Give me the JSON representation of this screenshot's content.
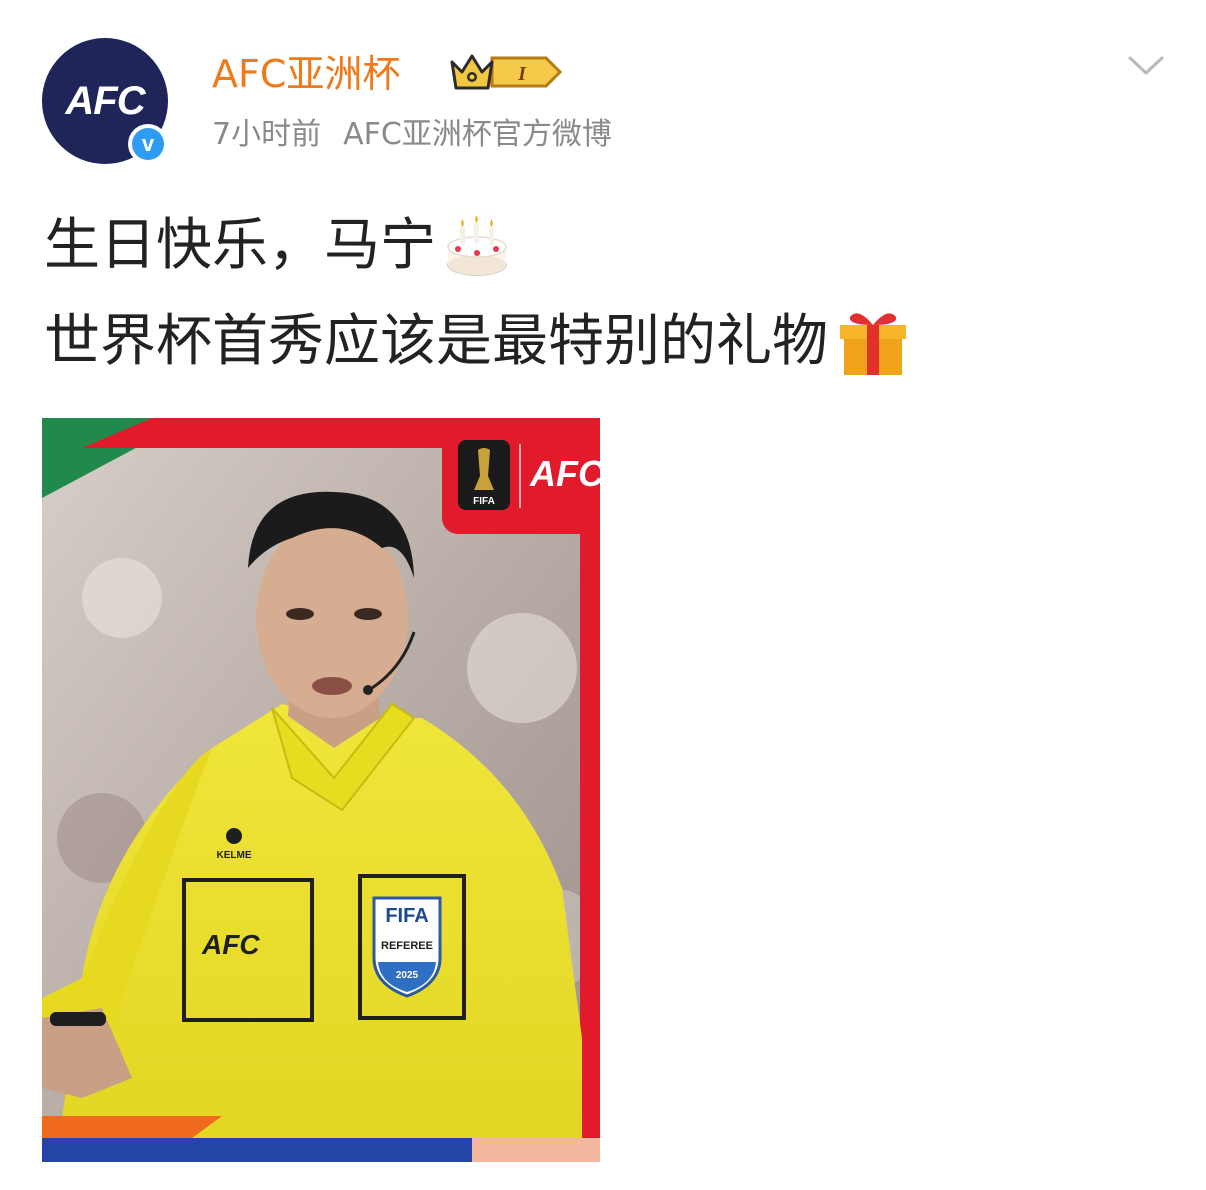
{
  "post": {
    "author": {
      "name": "AFC亚洲杯",
      "avatar_text": "AFC",
      "verified_mark": "v",
      "badge_level": "I"
    },
    "time": "7小时前",
    "source": "AFC亚洲杯官方微博",
    "text_lines": [
      "生日快乐，马宁",
      "世界杯首秀应该是最特别的礼物"
    ],
    "text_emojis": [
      "birthday-cake",
      "gift-box"
    ],
    "image": {
      "corner_logo": "AFC",
      "trophy_label": "FIFA",
      "chest_logo": "AFC",
      "shirt_brand": "KELME",
      "badge_top": "FIFA",
      "badge_middle": "REFEREE",
      "badge_year": "2025"
    }
  },
  "colors": {
    "name": "#f07a1a",
    "meta": "#8a8a8a",
    "text": "#222222",
    "avatar_bg": "#1f2459",
    "verified": "#2f9cf3",
    "jersey": "#ece32c",
    "frame_red": "#e11a2c"
  }
}
